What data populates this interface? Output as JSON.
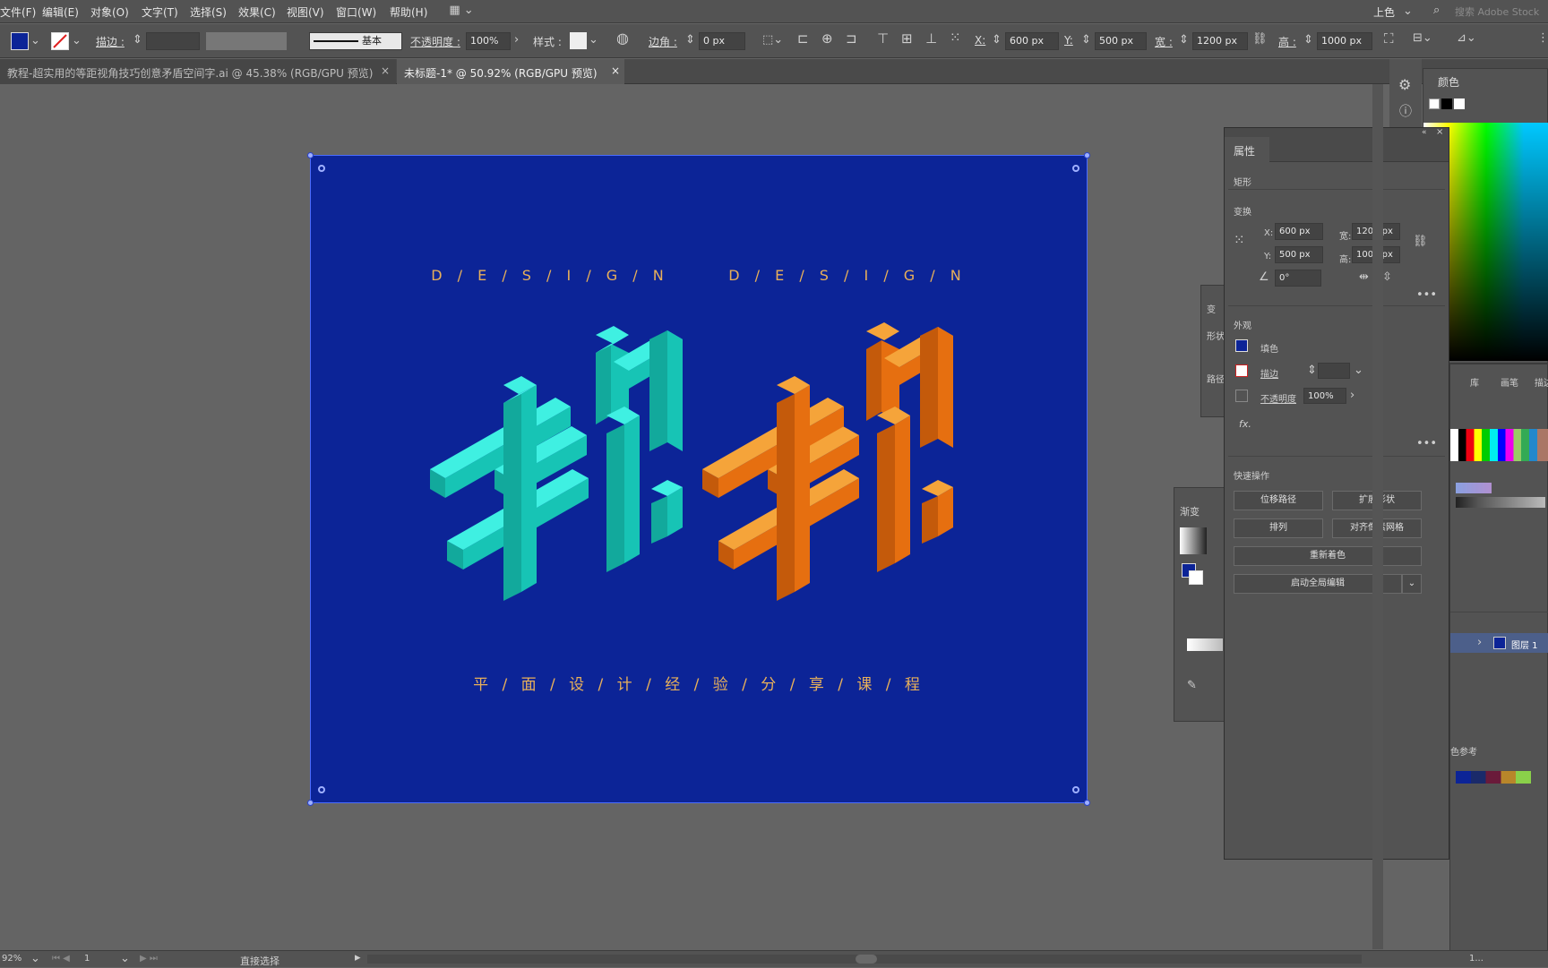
{
  "menu": [
    "文件(F)",
    "编辑(E)",
    "对象(O)",
    "文字(T)",
    "选择(S)",
    "效果(C)",
    "视图(V)",
    "窗口(W)",
    "帮助(H)"
  ],
  "menu_right": {
    "workspace": "上色",
    "search_placeholder": "搜索 Adobe Stock"
  },
  "control": {
    "stroke_label": "描边 :",
    "brush_label": "基本",
    "opacity_label": "不透明度 :",
    "opacity_value": "100%",
    "style_label": "样式 :",
    "corner_label": "边角 :",
    "corner_value": "0 px",
    "x_label": "X:",
    "x_value": "600 px",
    "y_label": "Y:",
    "y_value": "500 px",
    "w_label": "宽 :",
    "w_value": "1200 px",
    "h_label": "高 :",
    "h_value": "1000 px",
    "fill_color": "#0c2497"
  },
  "tabs": [
    {
      "label": "教程-超实用的等距视角技巧创意矛盾空间字.ai @ 45.38% (RGB/GPU 预览)",
      "close": "×"
    },
    {
      "label": "未标题-1* @ 50.92% (RGB/GPU 预览)",
      "close": "×"
    }
  ],
  "artwork": {
    "design_line": "D / E / S / I / G / N      D / E / S / I / G / N",
    "subtitle": "平 / 面 / 设 / 计 / 经 / 验 / 分 / 享 / 课 / 程",
    "bg": "#0c2497",
    "cyan": "#19d9c9",
    "orange": "#ee8a12"
  },
  "properties": {
    "tab": "属性",
    "object_type": "矩形",
    "transform_title": "变换",
    "x_label": "X:",
    "x": "600 px",
    "w_label": "宽:",
    "w": "1200 px",
    "y_label": "Y:",
    "y": "500 px",
    "h_label": "高:",
    "h": "1000 px",
    "angle": "0°",
    "appearance_title": "外观",
    "fill_label": "填色",
    "stroke_label": "描边",
    "opacity_label": "不透明度",
    "opacity": "100%",
    "fx": "fx.",
    "quick_title": "快速操作",
    "buttons": [
      "位移路径",
      "扩展形状",
      "排列",
      "对齐像素网格",
      "重新着色",
      "启动全局编辑"
    ]
  },
  "color_panel": {
    "title": "颜色"
  },
  "side_tabs": {
    "lib": "库",
    "brush": "画笔",
    "desc": "描边"
  },
  "gradient_panel": {
    "title": "渐变"
  },
  "back_panel": {
    "a": "变",
    "b": "形状",
    "c": "路径"
  },
  "layers": {
    "layer": "图层 1"
  },
  "guide": {
    "title": "色参考"
  },
  "status": {
    "zoom": "92%",
    "page": "1",
    "tool": "直接选择",
    "right": "1..."
  }
}
